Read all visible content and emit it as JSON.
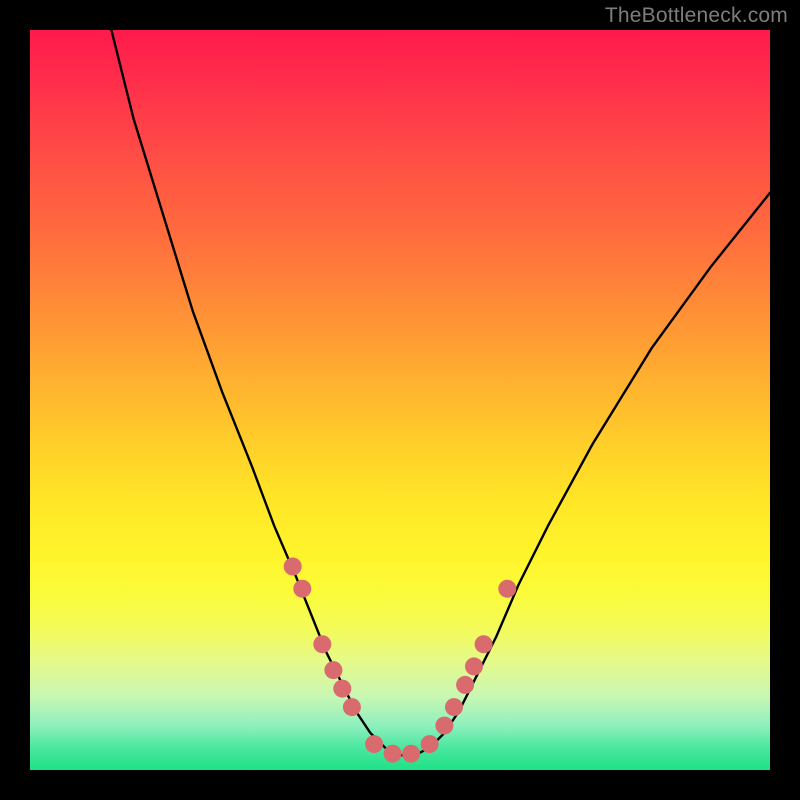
{
  "watermark": "TheBottleneck.com",
  "chart_data": {
    "type": "line",
    "title": "",
    "xlabel": "",
    "ylabel": "",
    "xlim": [
      0,
      100
    ],
    "ylim": [
      0,
      100
    ],
    "series": [
      {
        "name": "bottleneck-curve",
        "x": [
          11,
          14,
          18,
          22,
          26,
          30,
          33,
          36,
          38,
          40,
          42,
          44,
          46,
          48,
          50,
          52,
          54,
          56,
          58,
          60,
          63,
          66,
          70,
          76,
          84,
          92,
          100
        ],
        "y": [
          100,
          88,
          75,
          62,
          51,
          41,
          33,
          26,
          21,
          16,
          12,
          8,
          5,
          3,
          2,
          2,
          3,
          5,
          8,
          12,
          18,
          25,
          33,
          44,
          57,
          68,
          78
        ]
      }
    ],
    "markers": {
      "name": "highlight-dots",
      "color": "#d96a6d",
      "x": [
        35.5,
        36.8,
        39.5,
        41.0,
        42.2,
        43.5,
        46.5,
        49.0,
        51.5,
        54.0,
        56.0,
        57.3,
        58.8,
        60.0,
        61.3,
        64.5
      ],
      "y": [
        27.5,
        24.5,
        17.0,
        13.5,
        11.0,
        8.5,
        3.5,
        2.2,
        2.2,
        3.5,
        6.0,
        8.5,
        11.5,
        14.0,
        17.0,
        24.5
      ]
    },
    "background": "rainbow-vertical-gradient"
  }
}
